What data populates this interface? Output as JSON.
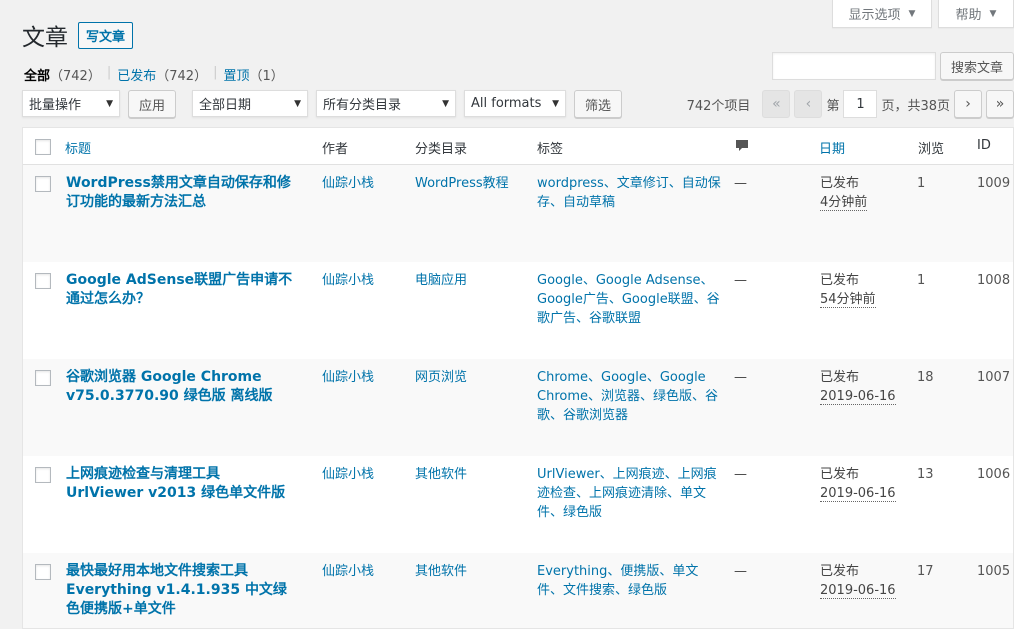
{
  "screen_meta": {
    "options_label": "显示选项",
    "help_label": "帮助"
  },
  "page": {
    "title": "文章",
    "add_new_label": "写文章"
  },
  "filters": {
    "all_label": "全部",
    "all_count": "（742）",
    "published_label": "已发布",
    "published_count": "（742）",
    "sticky_label": "置顶",
    "sticky_count": "（1）"
  },
  "search": {
    "input_value": "",
    "button_label": "搜索文章"
  },
  "tablenav": {
    "bulk_action": "批量操作",
    "apply_label": "应用",
    "date_filter": "全部日期",
    "category_filter": "所有分类目录",
    "format_filter": "All formats",
    "filter_label": "筛选",
    "items_count": "742个项目",
    "first_page": "«",
    "prev_page": "‹",
    "page_prefix": "第",
    "current_page": "1",
    "page_suffix": "页，共38页",
    "next_page": "›",
    "last_page": "»"
  },
  "columns": {
    "title": "标题",
    "author": "作者",
    "categories": "分类目录",
    "tags": "标签",
    "comments_icon": "comment-bubble-icon",
    "date": "日期",
    "views": "浏览",
    "id": "ID"
  },
  "posts": [
    {
      "title": "WordPress禁用文章自动保存和修订功能的最新方法汇总",
      "author": "仙踪小栈",
      "category": "WordPress教程",
      "tags": "wordpress、文章修订、自动保存、自动草稿",
      "comments": "—",
      "status": "已发布",
      "date": "4分钟前",
      "views": "1",
      "id": "1009"
    },
    {
      "title": "Google AdSense联盟广告申请不通过怎么办？",
      "author": "仙踪小栈",
      "category": "电脑应用",
      "tags": "Google、Google Adsense、Google广告、Google联盟、谷歌广告、谷歌联盟",
      "comments": "—",
      "status": "已发布",
      "date": "54分钟前",
      "views": "1",
      "id": "1008"
    },
    {
      "title": "谷歌浏览器 Google Chrome v75.0.3770.90 绿色版 离线版",
      "author": "仙踪小栈",
      "category": "网页浏览",
      "tags": "Chrome、Google、Google Chrome、浏览器、绿色版、谷歌、谷歌浏览器",
      "comments": "—",
      "status": "已发布",
      "date": "2019-06-16",
      "views": "18",
      "id": "1007"
    },
    {
      "title": "上网痕迹检查与清理工具 UrlViewer v2013 绿色单文件版",
      "author": "仙踪小栈",
      "category": "其他软件",
      "tags": "UrlViewer、上网痕迹、上网痕迹检查、上网痕迹清除、单文件、绿色版",
      "comments": "—",
      "status": "已发布",
      "date": "2019-06-16",
      "views": "13",
      "id": "1006"
    },
    {
      "title": "最快最好用本地文件搜索工具 Everything v1.4.1.935 中文绿色便携版+单文件",
      "author": "仙踪小栈",
      "category": "其他软件",
      "tags": "Everything、便携版、单文件、文件搜索、绿色版",
      "comments": "—",
      "status": "已发布",
      "date": "2019-06-16",
      "views": "17",
      "id": "1005"
    }
  ]
}
